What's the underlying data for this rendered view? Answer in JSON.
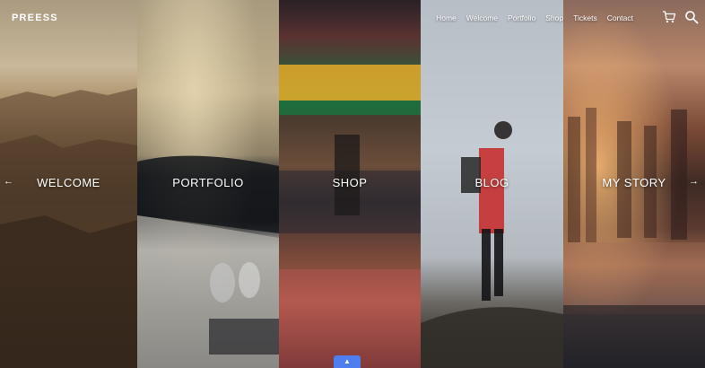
{
  "brand": {
    "logo": "PREESS"
  },
  "nav": {
    "items": [
      "Home",
      "Welcome",
      "Portfolio",
      "Shop",
      "Tickets",
      "Contact"
    ]
  },
  "icons": {
    "cart": "shopping-cart-icon",
    "search": "search-icon",
    "left": "arrow-left-icon",
    "right": "arrow-right-icon",
    "up": "chevron-up-icon"
  },
  "panels": [
    {
      "label": "WELCOME"
    },
    {
      "label": "PORTFOLIO"
    },
    {
      "label": "SHOP"
    },
    {
      "label": "BLOG"
    },
    {
      "label": "MY STORY"
    }
  ],
  "colors": {
    "accent": "#4f7ef0"
  }
}
